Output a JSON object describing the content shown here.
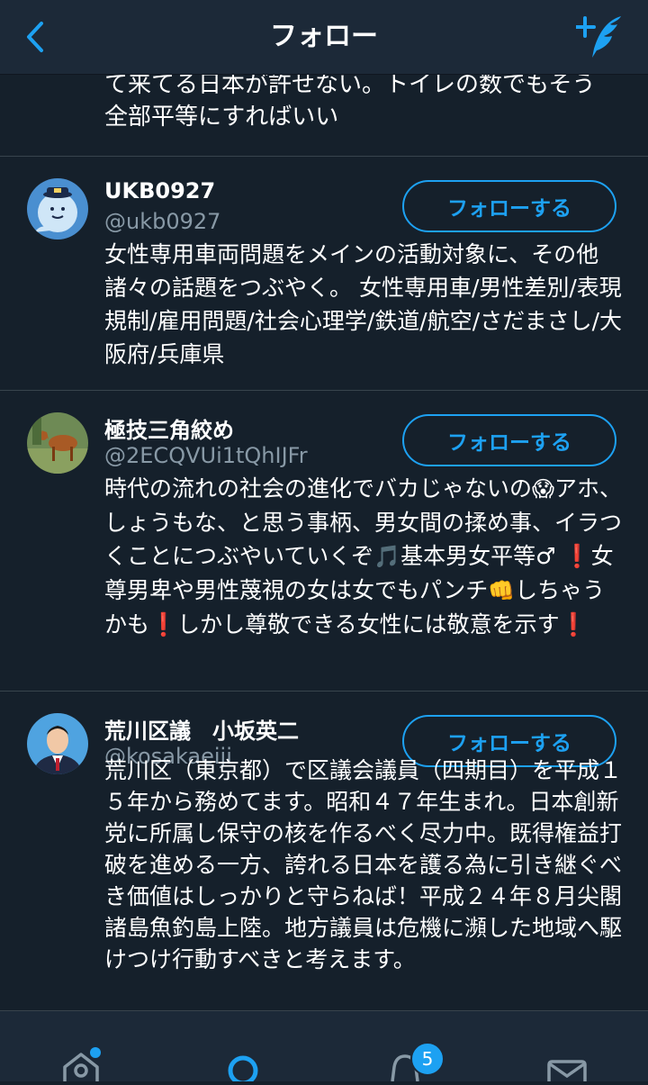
{
  "header": {
    "title": "フォロー"
  },
  "partial_bio": {
    "line1": "て来てる日本が許せない。トイレの数でもそう",
    "line2": "全部平等にすればいい"
  },
  "users": [
    {
      "name": "UKB0927",
      "handle": "@ukb0927",
      "follow_label": "フォローする",
      "bio": "女性専用車両問題をメインの活動対象に、その他諸々の話題をつぶやく。 女性専用車/男性差別/表現規制/雇用問題/社会心理学/鉄道/航空/さだまさし/大阪府/兵庫県"
    },
    {
      "name": "極技三角絞め",
      "handle": "@2ECQVUi1tQhIJFr",
      "follow_label": "フォローする",
      "bio_parts": {
        "p1": "時代の流れの社会の進化でバカじゃないの",
        "e1": "😱",
        "p2": "アホ、しょうもな、と思う事柄、男女間の揉め事、イラつくことにつぶやいていくぞ",
        "e2": "🎵",
        "p3": "基本男女平等♂ ",
        "e3": "❗",
        "p4": "女尊男卑や男性蔑視の女は女でもパンチ",
        "e4": "👊",
        "p5": "しちゃうかも",
        "e5": "❗",
        "p6": "しかし尊敬できる女性には敬意を示す",
        "e6": "❗"
      }
    },
    {
      "name": "荒川区議　小坂英二",
      "handle": "@kosakaeiji",
      "follow_label": "フォローする",
      "bio": "荒川区（東京都）で区議会議員（四期目）を平成１５年から務めてます。昭和４７年生まれ。日本創新党に所属し保守の核を作るべく尽力中。既得権益打破を進める一方、誇れる日本を護る為に引き継ぐべき価値はしっかりと守らねば！平成２４年８月尖閣諸島魚釣島上陸。地方議員は危機に瀕した地域へ駆けつけ行動すべきと考えます。"
    }
  ],
  "tabbar": {
    "notifications_badge": "5"
  },
  "colors": {
    "accent": "#1da1f2",
    "background": "#15202b",
    "bar": "#1c2938",
    "secondary_text": "#8899a6"
  }
}
